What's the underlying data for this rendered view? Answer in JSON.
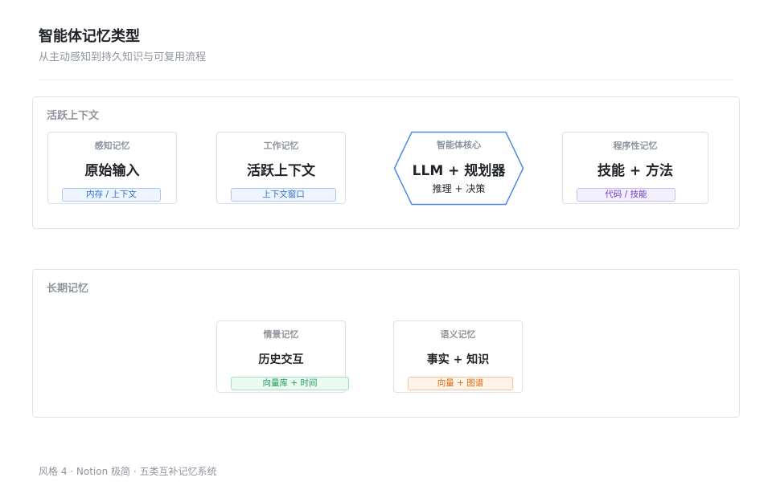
{
  "header": {
    "title": "智能体记忆类型",
    "subtitle": "从主动感知到持久知识与可复用流程"
  },
  "active_context": {
    "label": "活跃上下文",
    "cards": [
      {
        "label": "感知记忆",
        "main": "原始输入",
        "tag": "内存 / 上下文"
      },
      {
        "label": "工作记忆",
        "main": "活跃上下文",
        "tag": "上下文窗口"
      },
      {
        "label": "程序性记忆",
        "main": "技能 + 方法",
        "tag": "代码 / 技能"
      }
    ],
    "core": {
      "label": "智能体核心",
      "main": "LLM + 规划器",
      "sub": "推理 + 决策"
    }
  },
  "long_term": {
    "label": "长期记忆",
    "cards": [
      {
        "label": "情景记忆",
        "main": "历史交互",
        "tag": "向量库 + 时间"
      },
      {
        "label": "语义记忆",
        "main": "事实 + 知识",
        "tag": "向量 + 图谱"
      }
    ]
  },
  "colors": {
    "core_border": "#4a8ae6",
    "tag_blue": "#2c6fd1",
    "tag_purple": "#6d3fd1",
    "tag_green": "#1e9a5a",
    "tag_orange": "#e0680f"
  },
  "footer": {
    "text": "风格 4 · Notion 极简 · 五类互补记忆系统"
  }
}
